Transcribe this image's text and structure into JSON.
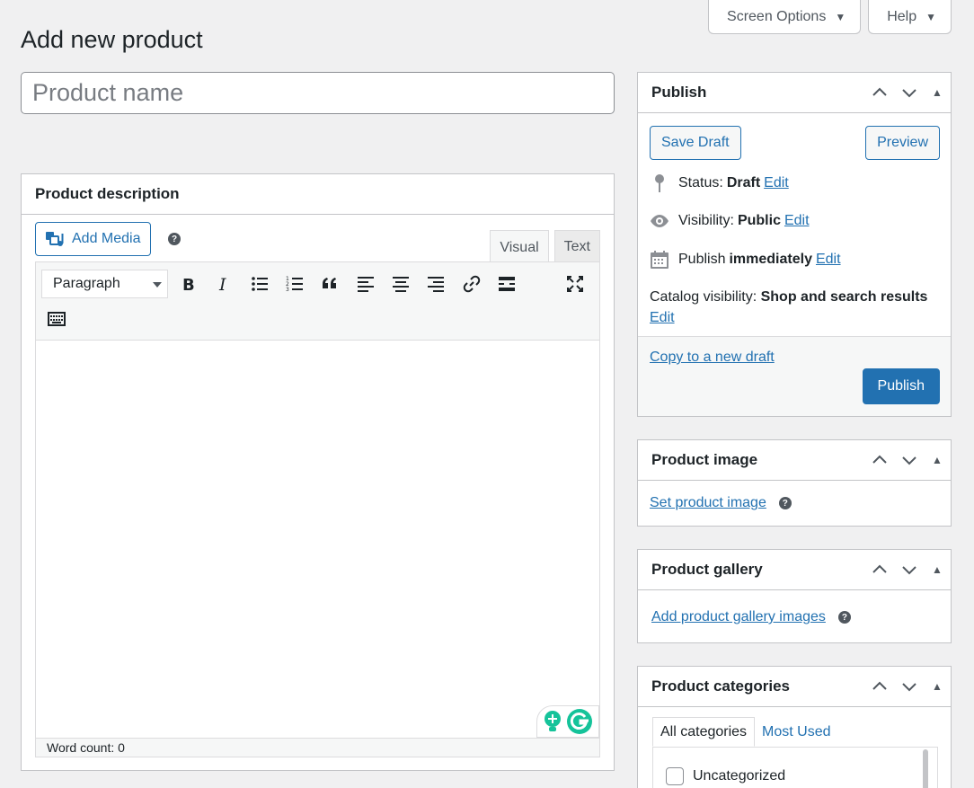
{
  "screen_tabs": {
    "screen_options": "Screen Options",
    "help": "Help"
  },
  "page": {
    "title": "Add new product",
    "name_placeholder": "Product name"
  },
  "description_box": {
    "title": "Product description",
    "add_media": "Add Media",
    "tabs": {
      "visual": "Visual",
      "text": "Text"
    },
    "format": "Paragraph",
    "word_count": "Word count: 0"
  },
  "publish_box": {
    "title": "Publish",
    "save_draft": "Save Draft",
    "preview": "Preview",
    "status_label": "Status:",
    "status_value": "Draft",
    "visibility_label": "Visibility:",
    "visibility_value": "Public",
    "publish_label": "Publish",
    "publish_value": "immediately",
    "edit": "Edit",
    "catalog_label": "Catalog visibility:",
    "catalog_value": "Shop and search results",
    "copy_draft": "Copy to a new draft",
    "publish_button": "Publish"
  },
  "image_box": {
    "title": "Product image",
    "link": "Set product image"
  },
  "gallery_box": {
    "title": "Product gallery",
    "link": "Add product gallery images"
  },
  "categories_box": {
    "title": "Product categories",
    "tab_all": "All categories",
    "tab_most_used": "Most Used",
    "items": [
      "Uncategorized"
    ]
  },
  "colors": {
    "accent": "#2271b1",
    "background": "#f0f0f1",
    "grammarly": "#15c39a"
  }
}
